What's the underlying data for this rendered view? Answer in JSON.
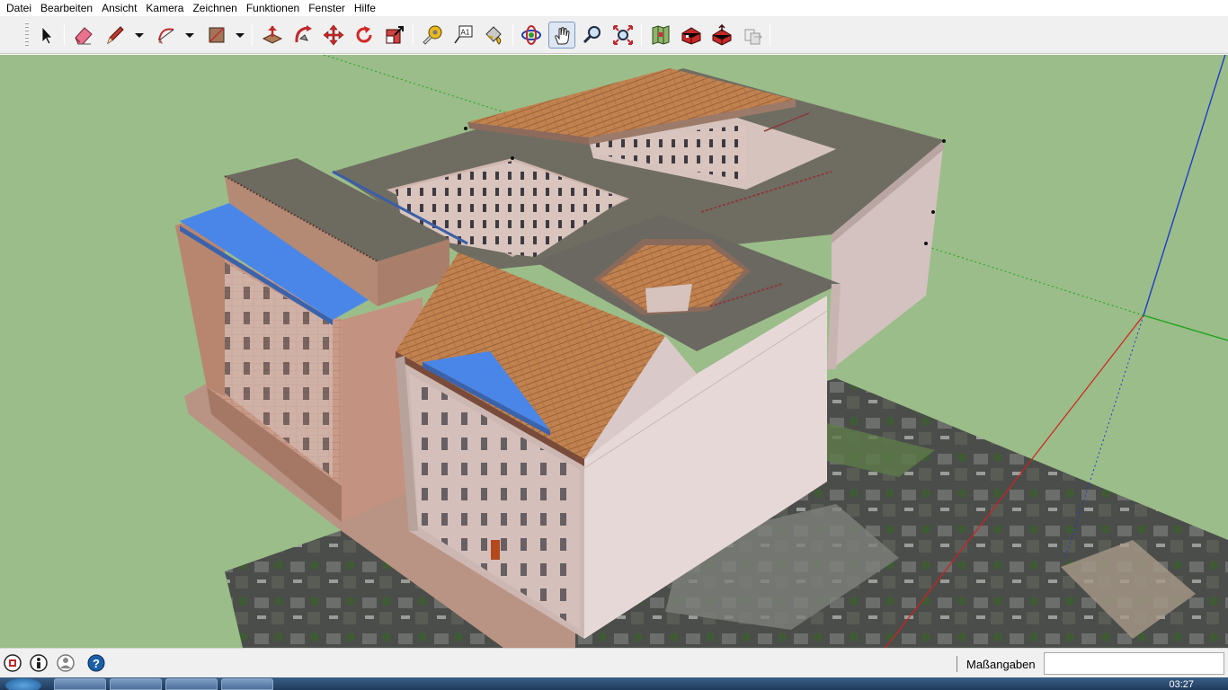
{
  "menu": [
    "Datei",
    "Bearbeiten",
    "Ansicht",
    "Kamera",
    "Zeichnen",
    "Funktionen",
    "Fenster",
    "Hilfe"
  ],
  "toolbar": {
    "tools": [
      {
        "name": "select-tool",
        "icon": "arrow-cursor-icon",
        "label": "Auswählen"
      },
      {
        "name": "eraser-tool",
        "icon": "eraser-icon",
        "label": "Radiergummi"
      },
      {
        "name": "pencil-tool",
        "icon": "pencil-icon",
        "label": "Linie"
      },
      {
        "name": "arc-tool",
        "icon": "arc-icon",
        "label": "Bogen"
      },
      {
        "name": "rectangle-tool",
        "icon": "rectangle-icon",
        "label": "Rechteck"
      },
      {
        "name": "push-pull-tool",
        "icon": "push-pull-icon",
        "label": "Drücken/Ziehen"
      },
      {
        "name": "follow-me-tool",
        "icon": "follow-me-icon",
        "label": "Folge mir"
      },
      {
        "name": "move-tool",
        "icon": "move-icon",
        "label": "Verschieben"
      },
      {
        "name": "rotate-tool",
        "icon": "rotate-icon",
        "label": "Drehen"
      },
      {
        "name": "scale-tool",
        "icon": "scale-icon",
        "label": "Skalieren"
      },
      {
        "name": "tape-measure-tool",
        "icon": "tape-measure-icon",
        "label": "Maßband"
      },
      {
        "name": "text-tool",
        "icon": "text-icon",
        "label": "Text"
      },
      {
        "name": "paint-bucket-tool",
        "icon": "paint-bucket-icon",
        "label": "Farbeimer"
      },
      {
        "name": "orbit-tool",
        "icon": "orbit-icon",
        "label": "Orbit"
      },
      {
        "name": "pan-tool",
        "icon": "hand-icon",
        "label": "Schwenken"
      },
      {
        "name": "zoom-tool",
        "icon": "magnifier-icon",
        "label": "Zoom"
      },
      {
        "name": "zoom-extents-tool",
        "icon": "zoom-extents-icon",
        "label": "Zoom Grenzen"
      },
      {
        "name": "location-tool",
        "icon": "map-location-icon",
        "label": "Standort"
      },
      {
        "name": "warehouse-tool",
        "icon": "warehouse-icon",
        "label": "3D Warehouse"
      },
      {
        "name": "share-model-tool",
        "icon": "share-model-icon",
        "label": "Modell freigeben"
      },
      {
        "name": "extension-tool",
        "icon": "extension-icon",
        "label": "Erweiterungen"
      }
    ],
    "active_tool": "pan-tool",
    "text_tool_glyph": "A1"
  },
  "viewport": {
    "ground_color": "#9bbd89",
    "axis_colors": {
      "red": "#d22020",
      "green": "#1aa31a",
      "blue": "#1f3ccc"
    }
  },
  "status": {
    "measure_label": "Maßangaben",
    "measure_value": ""
  },
  "taskbar": {
    "clock": "03:27"
  }
}
